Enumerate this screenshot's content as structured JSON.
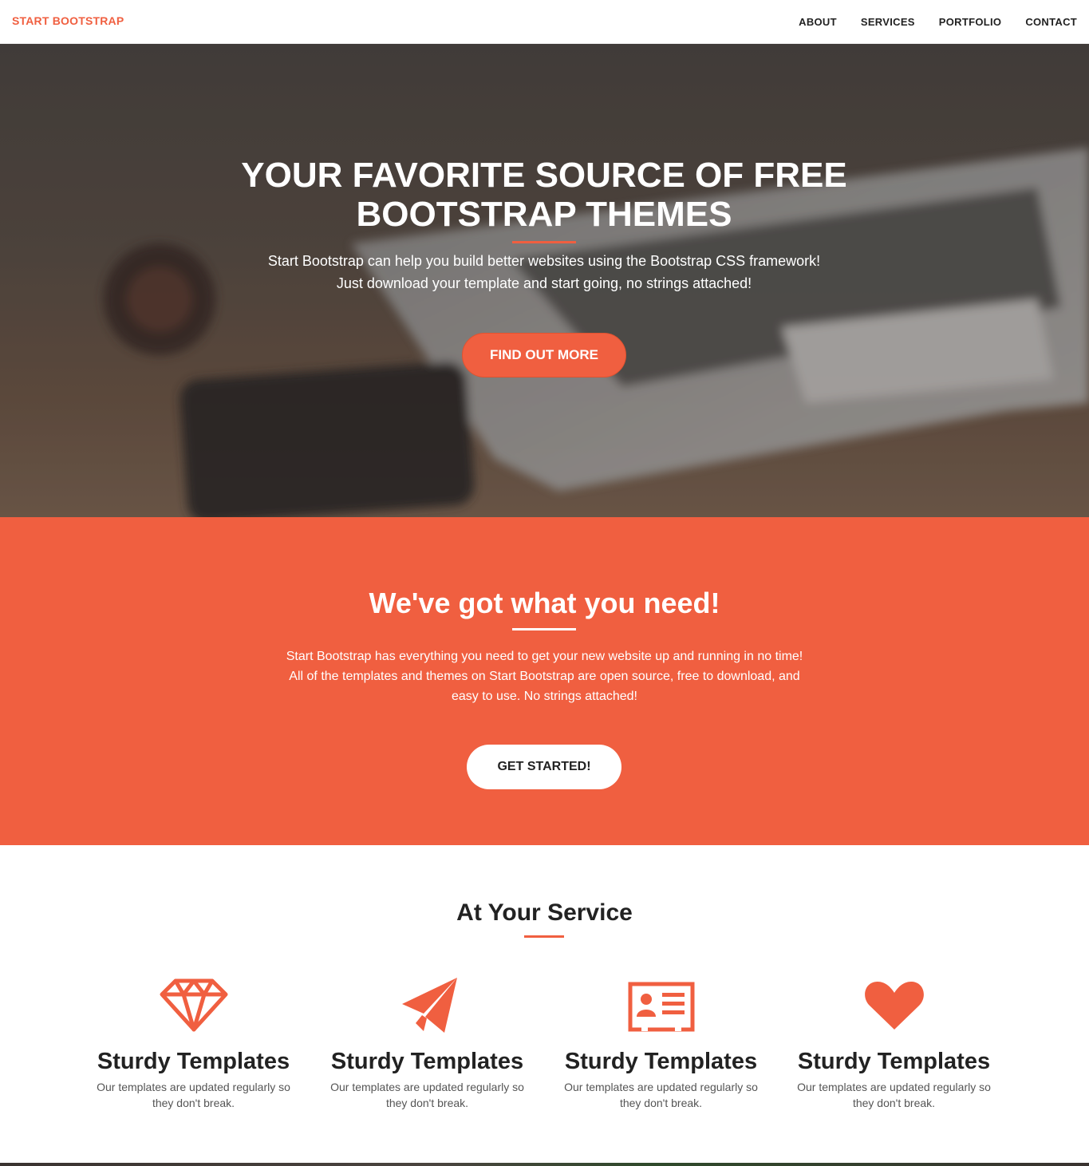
{
  "nav": {
    "brand": "START BOOTSTRAP",
    "links": [
      "ABOUT",
      "SERVICES",
      "PORTFOLIO",
      "CONTACT"
    ]
  },
  "hero": {
    "title": "YOUR FAVORITE SOURCE OF FREE BOOTSTRAP THEMES",
    "text_lines": [
      "Start Bootstrap can help you build better websites using the Bootstrap CSS framework!",
      "Just download your template and start going, no strings attached!"
    ],
    "button": "FIND OUT MORE"
  },
  "about": {
    "title": "We've got what you need!",
    "text_lines": [
      "Start Bootstrap has everything you need to get your new website up and running in no time!",
      "All of the templates and themes on Start Bootstrap are open source, free to download, and",
      "easy to use. No strings attached!"
    ],
    "button": "GET STARTED!"
  },
  "services": {
    "title": "At Your Service",
    "items": [
      {
        "icon": "diamond-icon",
        "heading": "Sturdy Templates",
        "text_lines": [
          "Our templates are updated regularly so",
          "they don't break."
        ]
      },
      {
        "icon": "paper-plane-icon",
        "heading": "Sturdy Templates",
        "text_lines": [
          "Our templates are updated regularly so",
          "they don't break."
        ]
      },
      {
        "icon": "id-card-icon",
        "heading": "Sturdy Templates",
        "text_lines": [
          "Our templates are updated regularly so",
          "they don't break."
        ]
      },
      {
        "icon": "heart-icon",
        "heading": "Sturdy Templates",
        "text_lines": [
          "Our templates are updated regularly so",
          "they don't break."
        ]
      }
    ]
  },
  "colors": {
    "accent": "#f05f40",
    "dark": "#222222",
    "white": "#ffffff"
  }
}
